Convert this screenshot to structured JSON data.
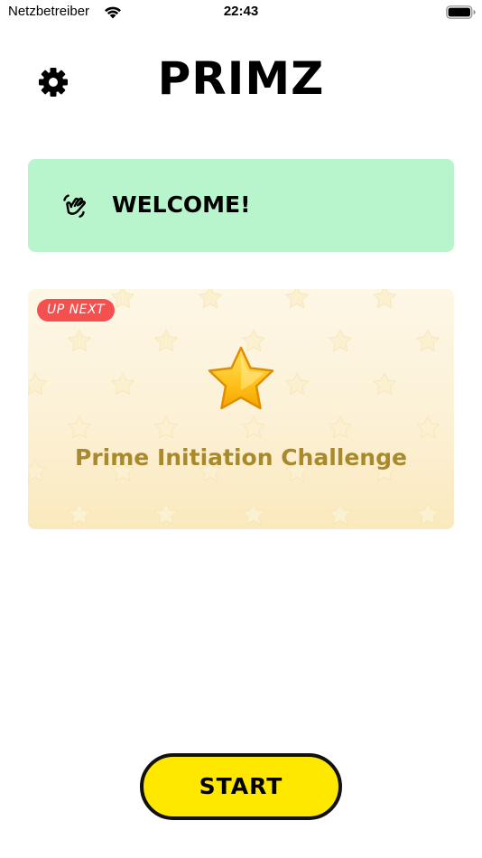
{
  "status_bar": {
    "carrier": "Netzbetreiber",
    "time": "22:43",
    "wifi_icon": "wifi-icon",
    "battery_icon": "battery-icon"
  },
  "header": {
    "title": "PRIMZ",
    "settings_icon": "gear-icon"
  },
  "welcome": {
    "text": "WELCOME!",
    "icon": "waving-hand-icon",
    "background": "#b9f5cc"
  },
  "up_next": {
    "badge": "UP NEXT",
    "title": "Prime Initiation Challenge",
    "icon": "star-icon",
    "badge_color": "#f55050",
    "title_color": "#a88a2c"
  },
  "actions": {
    "start_label": "START",
    "start_color": "#ffe800"
  }
}
